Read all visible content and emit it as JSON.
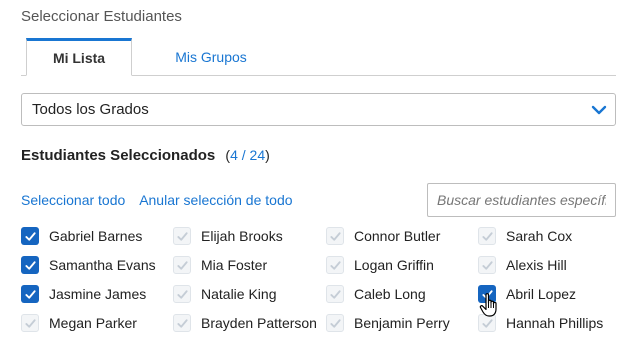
{
  "title": "Seleccionar Estudiantes",
  "tabs": [
    {
      "label": "Mi Lista",
      "active": true
    },
    {
      "label": "Mis Grupos",
      "active": false
    }
  ],
  "grade_select": {
    "value": "Todos los Grados",
    "icon": "chevron-down-icon"
  },
  "selected": {
    "label": "Estudiantes Seleccionados",
    "open": "(",
    "count": "4 / 24",
    "close": ")"
  },
  "actions": {
    "select_all": "Seleccionar todo",
    "deselect_all": "Anular selección de todo"
  },
  "search": {
    "placeholder": "Buscar estudiantes específicos"
  },
  "colors": {
    "accent": "#1976d2",
    "checked": "#1565c0",
    "unchecked": "#f3f5f7"
  },
  "students": [
    {
      "name": "Gabriel Barnes",
      "checked": true
    },
    {
      "name": "Elijah Brooks",
      "checked": false
    },
    {
      "name": "Connor Butler",
      "checked": false
    },
    {
      "name": "Sarah Cox",
      "checked": false
    },
    {
      "name": "Samantha Evans",
      "checked": true
    },
    {
      "name": "Mia Foster",
      "checked": false
    },
    {
      "name": "Logan Griffin",
      "checked": false
    },
    {
      "name": "Alexis Hill",
      "checked": false
    },
    {
      "name": "Jasmine James",
      "checked": true
    },
    {
      "name": "Natalie King",
      "checked": false
    },
    {
      "name": "Caleb Long",
      "checked": false
    },
    {
      "name": "Abril Lopez",
      "checked": true
    },
    {
      "name": "Megan Parker",
      "checked": false
    },
    {
      "name": "Brayden Patterson",
      "checked": false
    },
    {
      "name": "Benjamin Perry",
      "checked": false
    },
    {
      "name": "Hannah Phillips",
      "checked": false
    }
  ]
}
